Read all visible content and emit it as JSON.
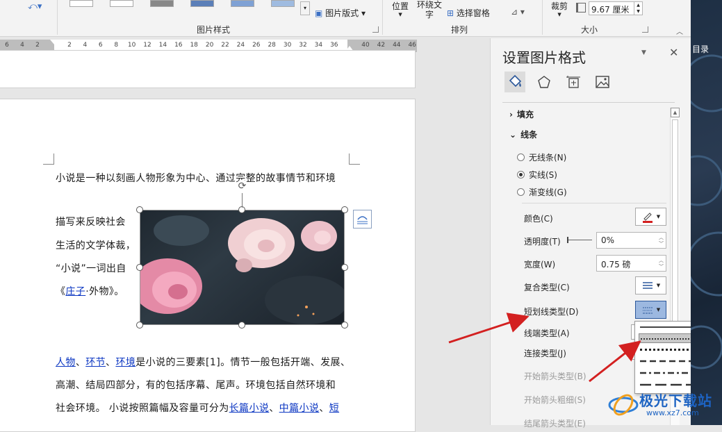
{
  "ribbon": {
    "position_label": "位置",
    "wrap_text_label": "环绕文字",
    "picture_layout_label": "图片版式",
    "selection_pane_label": "选择窗格",
    "crop_label": "裁剪",
    "width_value": "9.67 厘米",
    "picture_styles_group": "图片样式",
    "arrange_group": "排列",
    "size_group": "大小"
  },
  "ruler": {
    "left_ticks": [
      "6",
      "4",
      "2"
    ],
    "ticks": [
      "2",
      "4",
      "6",
      "8",
      "10",
      "12",
      "14",
      "16",
      "18",
      "20",
      "22",
      "24",
      "26",
      "28",
      "30",
      "32",
      "34",
      "36"
    ],
    "right_ticks": [
      "40",
      "42",
      "44",
      "46"
    ]
  },
  "document": {
    "line1": "小说是一种以刻画人物形象为中心、通过完整的故事情节和环境",
    "wrap_lines": [
      "描写来反映社会",
      "生活的文学体裁，",
      "“小说”一词出自"
    ],
    "zhuangzi_open": "《",
    "zhuangzi_link": "庄子",
    "zhuangzi_close": "·外物》。",
    "para2_links": [
      "人物",
      "环节",
      "环境"
    ],
    "para2_sep": "、",
    "para2_line1_rest": "是小说的三要素[1]。情节一般包括开端、发展、",
    "para2_line2": "高潮、结局四部分，有的包括序幕、尾声。环境包括自然环境和",
    "para2_line3_start": "社会环境。 小说按照篇幅及容量可分为",
    "para2_link_long": "长篇小说",
    "para2_link_mid": "中篇小说",
    "para2_link_short": "短"
  },
  "panel": {
    "title": "设置图片格式",
    "fill_section": "填充",
    "line_section": "线条",
    "radios": [
      "无线条(N)",
      "实线(S)",
      "渐变线(G)"
    ],
    "selected_radio": "实线(S)",
    "color_label": "颜色(C)",
    "transparency_label": "透明度(T)",
    "transparency_value": "0%",
    "width_label": "宽度(W)",
    "width_value": "0.75 磅",
    "compound_label": "复合类型(C)",
    "dash_label": "短划线类型(D)",
    "cap_label": "线端类型(A)",
    "join_label": "连接类型(J)",
    "begin_arrow_type": "开始箭头类型(B)",
    "begin_arrow_size": "开始箭头粗细(S)",
    "end_arrow_type": "结尾箭头类型(E)",
    "accent": "#2b579a"
  },
  "dash_menu": {
    "options": [
      "solid",
      "round-dot",
      "square-dot",
      "dash",
      "dash-dot",
      "long-dash"
    ],
    "highlighted": "round-dot"
  },
  "right_strip": {
    "label": "目录"
  },
  "watermark": {
    "text": "极光下载站",
    "url_text": "www.xz7.com"
  },
  "colors": {
    "arrow_red": "#d32020",
    "link_blue": "#0b36c2"
  }
}
